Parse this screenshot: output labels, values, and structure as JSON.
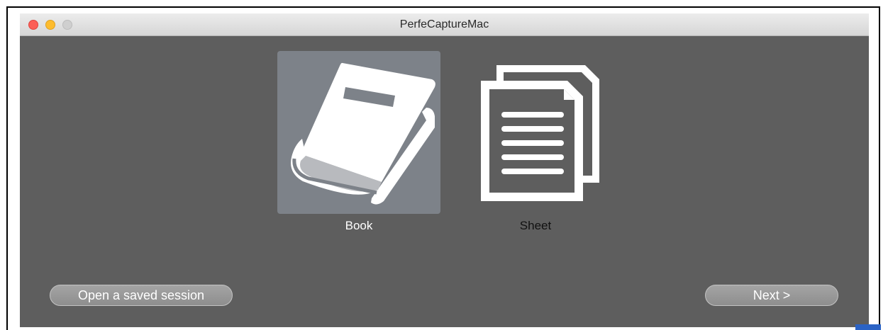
{
  "window": {
    "title": "PerfeCaptureMac",
    "controls": [
      "close",
      "minimize",
      "zoom"
    ]
  },
  "options": [
    {
      "id": "book",
      "label": "Book",
      "icon": "book-icon",
      "selected": true
    },
    {
      "id": "sheet",
      "label": "Sheet",
      "icon": "sheet-icon",
      "selected": false
    }
  ],
  "buttons": {
    "open_session": "Open a saved session",
    "next": "Next >"
  },
  "colors": {
    "window_bg": "#5e5e5e",
    "selected_bg": "#7d8289",
    "close": "#fc5f57",
    "minimize": "#fdbc2e",
    "zoom": "#cfcfcf"
  }
}
